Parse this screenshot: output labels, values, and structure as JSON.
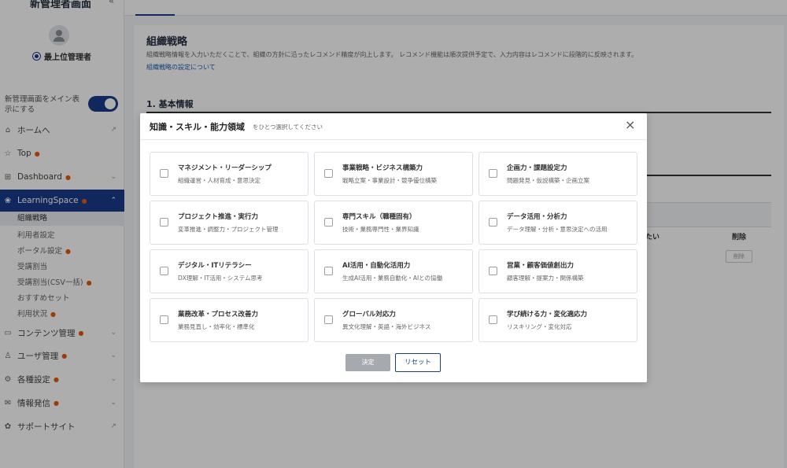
{
  "sidebar": {
    "title": "新管理者画面",
    "user_role": "最上位管理者",
    "toggle_label": "新管理画面をメイン表示にする",
    "items": [
      {
        "label": "ホームへ",
        "icon": "home-icon",
        "tail": "↗"
      },
      {
        "label": "Top",
        "icon": "star-icon",
        "dot": "●",
        "tail": ""
      },
      {
        "label": "Dashboard",
        "icon": "grid-icon",
        "dot": "●",
        "tail": "⌄"
      },
      {
        "label": "LearningSpace",
        "icon": "learning-icon",
        "dot": "●",
        "tail": "⌃"
      },
      {
        "label": "コンテンツ管理",
        "icon": "content-icon",
        "dot": "●",
        "tail": "⌄"
      },
      {
        "label": "ユーザ管理",
        "icon": "user-icon",
        "dot": "●",
        "tail": "⌄"
      },
      {
        "label": "各種設定",
        "icon": "settings-icon",
        "dot": "●",
        "tail": "⌄"
      },
      {
        "label": "情報発信",
        "icon": "mail-icon",
        "dot": "●",
        "tail": "⌄"
      },
      {
        "label": "サポートサイト",
        "icon": "support-icon",
        "tail": "↗"
      }
    ],
    "subitems": [
      {
        "label": "組織戦略"
      },
      {
        "label": "利用者設定"
      },
      {
        "label": "ポータル設定",
        "dot": "●"
      },
      {
        "label": "受講割当"
      },
      {
        "label": "受講割当(CSV一括)",
        "dot": "●"
      },
      {
        "label": "おすすめセット"
      },
      {
        "label": "利用状況",
        "dot": "●"
      }
    ]
  },
  "page": {
    "title": "組織戦略",
    "description": "組織戦略情報を入力いただくことで、組織の方針に沿ったレコメンド精度が向上します。 レコメンド機能は順次提供予定で、入力内容はレコメンドに段階的に反映されます。",
    "link": "組織戦略の設定について",
    "section_title": "1. 基本情報",
    "table_header_1": "たい",
    "table_header_2": "削除",
    "delete_button": "削除"
  },
  "modal": {
    "title": "知識・スキル・能力領域",
    "subtitle": "をひとつ選択してください",
    "close_icon": "×",
    "options": [
      {
        "title": "マネジメント・リーダーシップ",
        "desc": "組織運営・人材育成・意思決定"
      },
      {
        "title": "事業戦略・ビジネス構築力",
        "desc": "戦略立案・事業設計・競争優位構築"
      },
      {
        "title": "企画力・課題設定力",
        "desc": "問題発見・仮説構築・企画立案"
      },
      {
        "title": "プロジェクト推進・実行力",
        "desc": "変革推進・調整力・プロジェクト管理"
      },
      {
        "title": "専門スキル（職種固有）",
        "desc": "技術・業務専門性・業界知識"
      },
      {
        "title": "データ活用・分析力",
        "desc": "データ理解・分析・意思決定への活用"
      },
      {
        "title": "デジタル・ITリテラシー",
        "desc": "DX理解・IT活用・システム思考"
      },
      {
        "title": "AI活用・自動化活用力",
        "desc": "生成AI活用・業務自動化・AIとの協働"
      },
      {
        "title": "営業・顧客価値創出力",
        "desc": "顧客理解・提案力・関係構築"
      },
      {
        "title": "業務改革・プロセス改善力",
        "desc": "業務見直し・効率化・標準化"
      },
      {
        "title": "グローバル対応力",
        "desc": "異文化理解・英語・海外ビジネス"
      },
      {
        "title": "学び続ける力・変化適応力",
        "desc": "リスキリング・変化対応"
      }
    ],
    "decide_label": "決定",
    "reset_label": "リセット"
  }
}
